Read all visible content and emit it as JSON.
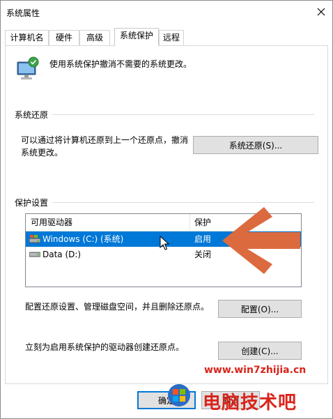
{
  "window": {
    "title": "系统属性"
  },
  "tabs": [
    {
      "label": "计算机名",
      "active": false
    },
    {
      "label": "硬件",
      "active": false
    },
    {
      "label": "高级",
      "active": false
    },
    {
      "label": "系统保护",
      "active": true
    },
    {
      "label": "远程",
      "active": false
    }
  ],
  "intro": {
    "text": "使用系统保护撤消不需要的系统更改。",
    "icon": "system-protection-icon"
  },
  "restore": {
    "section_label": "系统还原",
    "description_line1": "可以通过将计算机还原到上一个还原点，撤消",
    "description_line2": "系统更改。",
    "button_label": "系统还原(S)..."
  },
  "protection": {
    "section_label": "保护设置",
    "columns": [
      "可用驱动器",
      "保护"
    ],
    "rows": [
      {
        "drive": "Windows (C:) (系统)",
        "status": "启用",
        "selected": true
      },
      {
        "drive": "Data (D:)",
        "status": "关闭",
        "selected": false
      }
    ],
    "configure_text": "配置还原设置、管理磁盘空间，并且删除还原点。",
    "configure_button": "配置(O)...",
    "create_text": "立刻为启用系统保护的驱动器创建还原点。",
    "create_button": "创建(C)..."
  },
  "footer": {
    "ok_button": "确定",
    "cancel_button": "取消"
  },
  "watermark": {
    "url": "www.win7zhijia.cn",
    "logo_text": "电脑技术吧"
  },
  "colors": {
    "selection": "#0078d7",
    "arrow": "#dc6a3f",
    "watermark_text": "#d9241b",
    "button_face": "#e1e1e1"
  }
}
